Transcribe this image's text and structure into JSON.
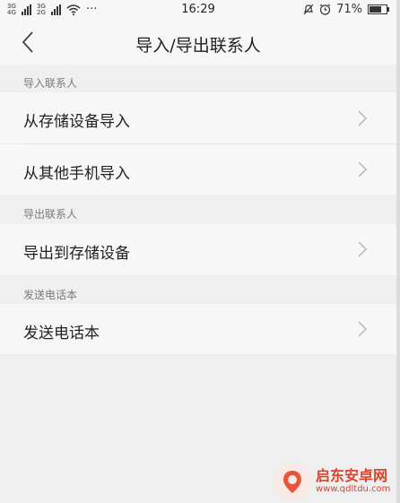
{
  "statusbar": {
    "net1": "3G 4G",
    "net2": "3G 2G",
    "more": "···",
    "time": "16:29",
    "battery_text": "71%",
    "battery_level": 0.71
  },
  "header": {
    "title": "导入/导出联系人",
    "back_icon": "chevron-left-icon"
  },
  "sections": [
    {
      "label": "导入联系人",
      "items": [
        {
          "label": "从存储设备导入"
        },
        {
          "label": "从其他手机导入"
        }
      ]
    },
    {
      "label": "导出联系人",
      "items": [
        {
          "label": "导出到存储设备"
        }
      ]
    },
    {
      "label": "发送电话本",
      "items": [
        {
          "label": "发送电话本"
        }
      ]
    }
  ],
  "watermark": {
    "text": "启东安卓网",
    "url": "www.qdltdu.com"
  }
}
